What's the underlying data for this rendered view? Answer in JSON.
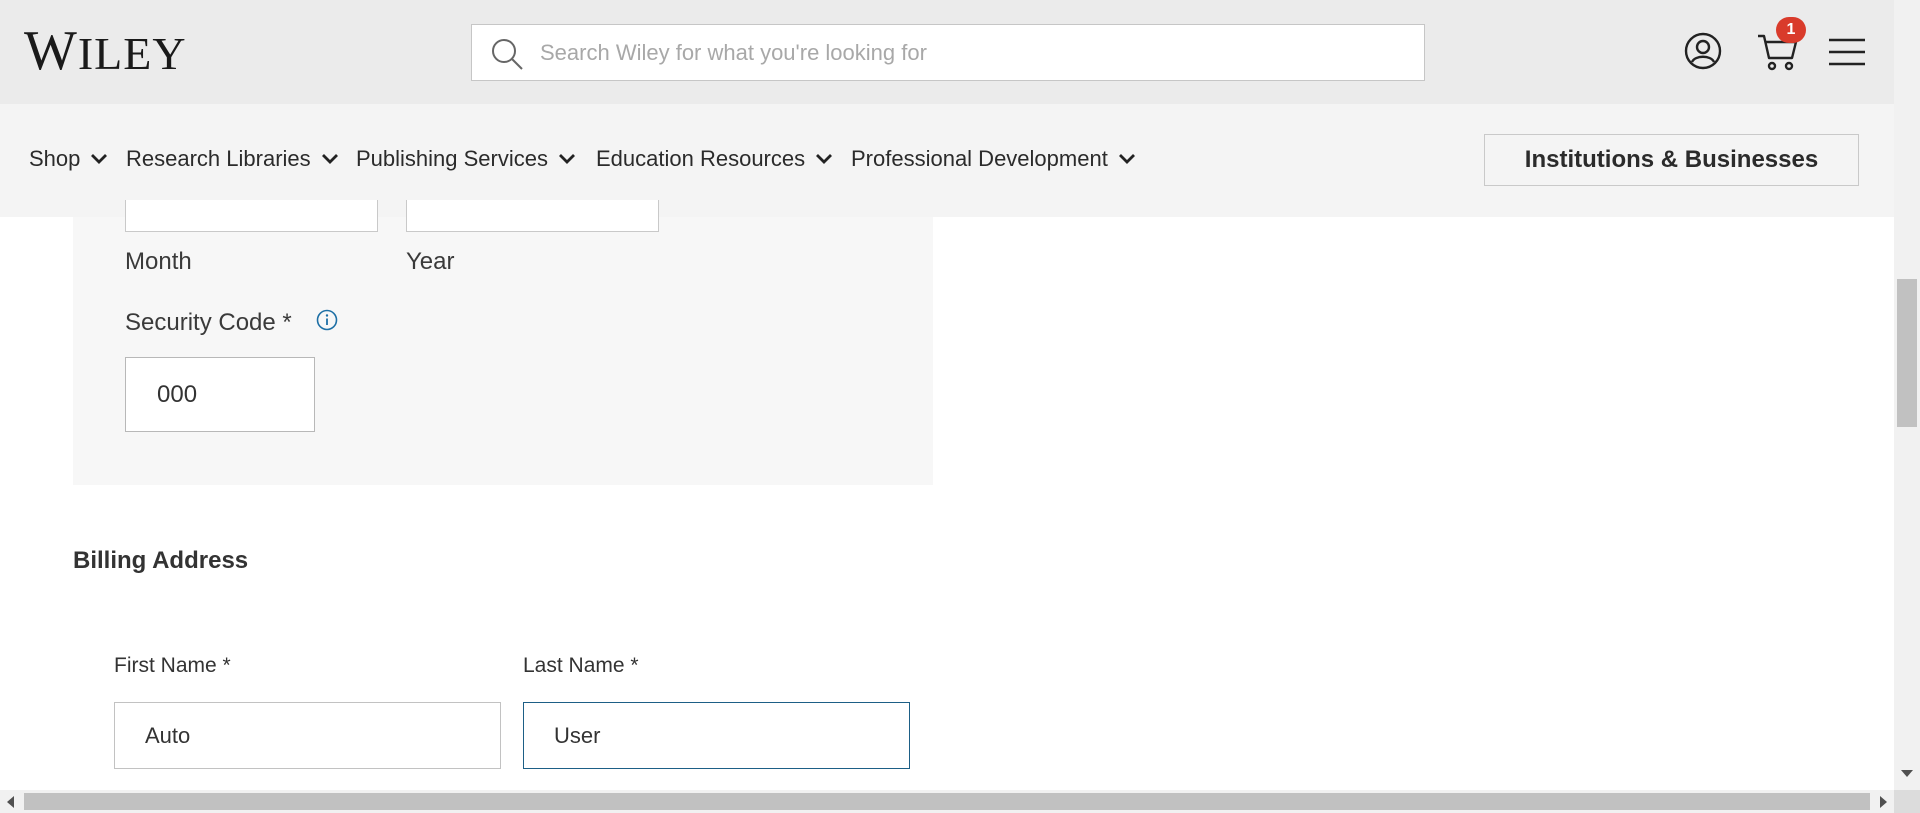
{
  "header": {
    "logo_initial": "W",
    "logo_rest": "ILEY",
    "search_placeholder": "Search Wiley for what you're looking for",
    "cart_count": "1",
    "badge_color": "#d93b2b"
  },
  "nav": {
    "items": [
      {
        "label": "Shop"
      },
      {
        "label": "Research Libraries"
      },
      {
        "label": "Publishing Services"
      },
      {
        "label": "Education Resources"
      },
      {
        "label": "Professional Development"
      }
    ],
    "institutions_button": "Institutions & Businesses"
  },
  "payment": {
    "month_label": "Month",
    "year_label": "Year",
    "security_code_label": "Security Code *",
    "security_code_value": "000"
  },
  "billing": {
    "title": "Billing Address",
    "first_name_label": "First Name *",
    "first_name_value": "Auto",
    "last_name_label": "Last Name *",
    "last_name_value": "User"
  },
  "colors": {
    "header_bg": "#ebebeb",
    "nav_bg": "#f4f4f4",
    "focus_border": "#1d5f86",
    "info_icon": "#1d6fa5"
  }
}
